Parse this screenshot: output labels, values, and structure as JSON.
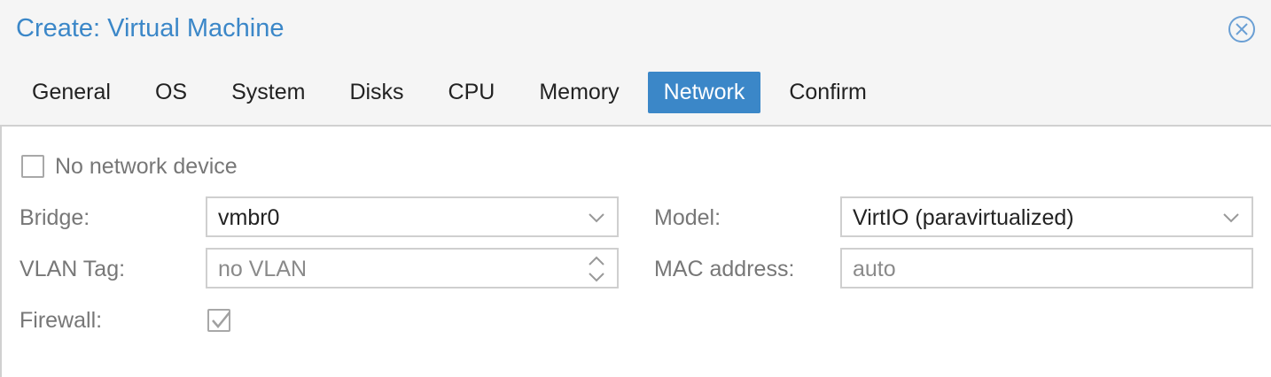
{
  "window": {
    "title": "Create: Virtual Machine"
  },
  "tabs": [
    {
      "label": "General"
    },
    {
      "label": "OS"
    },
    {
      "label": "System"
    },
    {
      "label": "Disks"
    },
    {
      "label": "CPU"
    },
    {
      "label": "Memory"
    },
    {
      "label": "Network",
      "active": true
    },
    {
      "label": "Confirm"
    }
  ],
  "form": {
    "no_network_device": {
      "label": "No network device",
      "checked": false
    },
    "bridge": {
      "label": "Bridge:",
      "value": "vmbr0"
    },
    "vlan_tag": {
      "label": "VLAN Tag:",
      "placeholder": "no VLAN"
    },
    "firewall": {
      "label": "Firewall:",
      "checked": true
    },
    "model": {
      "label": "Model:",
      "value": "VirtIO (paravirtualized)"
    },
    "mac_address": {
      "label": "MAC address:",
      "placeholder": "auto"
    }
  },
  "colors": {
    "accent": "#3b87c8",
    "tab_active_text": "#ffffff",
    "label_text": "#777777",
    "field_border": "#cfcfcf"
  },
  "icons": {
    "close": "close-circle-icon",
    "dropdown": "chevron-down-icon",
    "spinner": "spinner-arrows-icon",
    "check": "checkmark-icon"
  }
}
